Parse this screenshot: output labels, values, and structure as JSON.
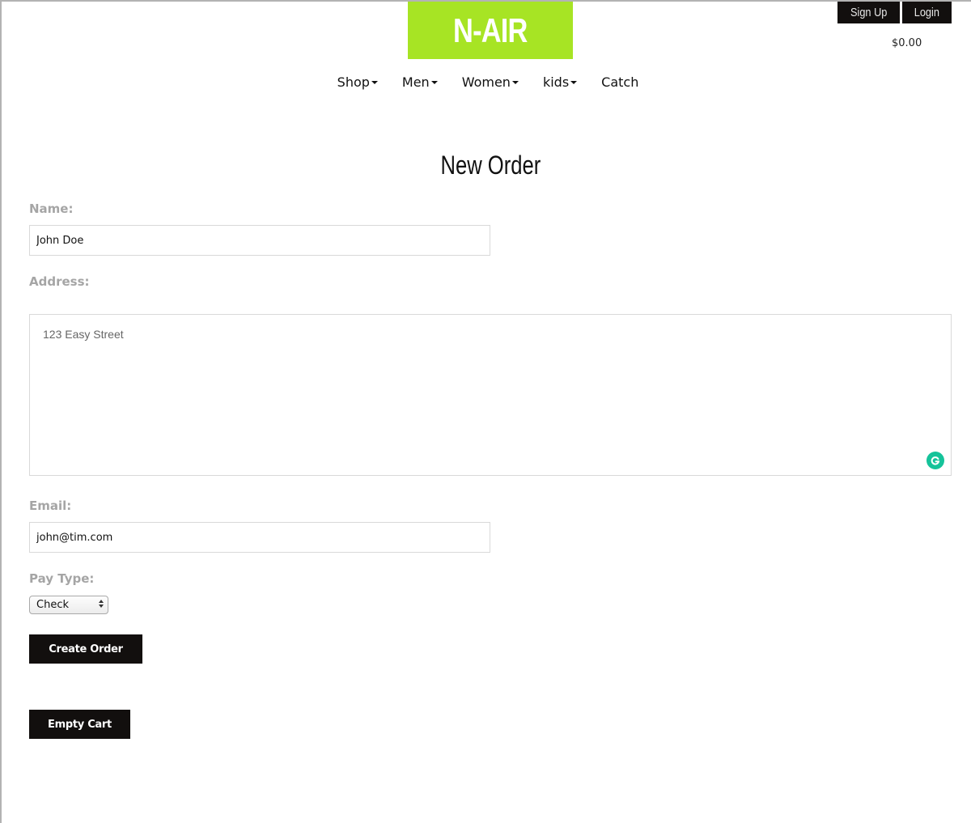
{
  "brand": {
    "logo_text": "N-AIR",
    "logo_color": "#a7e424"
  },
  "auth": {
    "sign_up_label": "Sign Up",
    "login_label": "Login"
  },
  "cart": {
    "total": "$0.00"
  },
  "nav": {
    "items": [
      {
        "label": "Shop",
        "dropdown": true
      },
      {
        "label": "Men",
        "dropdown": true
      },
      {
        "label": "Women",
        "dropdown": true
      },
      {
        "label": "kids",
        "dropdown": true
      },
      {
        "label": "Catch",
        "dropdown": false
      }
    ]
  },
  "page": {
    "title": "New Order"
  },
  "form": {
    "name_label": "Name:",
    "name_value": "John Doe",
    "address_label": "Address:",
    "address_value": "123 Easy Street",
    "email_label": "Email:",
    "email_value": "john@tim.com",
    "pay_type_label": "Pay Type:",
    "pay_type_value": "Check",
    "create_order_label": "Create Order"
  },
  "actions": {
    "empty_cart_label": "Empty Cart"
  },
  "colors": {
    "button_bg": "#120f0e",
    "label_gray": "#a5a5a5",
    "grammarly_green": "#15c39a"
  }
}
